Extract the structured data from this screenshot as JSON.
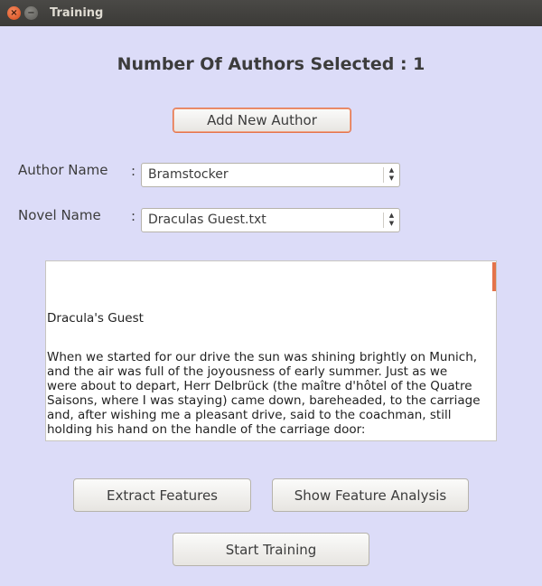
{
  "window": {
    "title": "Training",
    "close_glyph": "×",
    "minimize_glyph": "−"
  },
  "heading": "Number Of Authors Selected : 1",
  "buttons": {
    "add_author": "Add New Author",
    "extract": "Extract Features",
    "analysis": "Show Feature Analysis",
    "train": "Start Training"
  },
  "author": {
    "label": "Author Name",
    "colon": ":",
    "value": "Bramstocker"
  },
  "novel": {
    "label": "Novel Name",
    "colon": ":",
    "value": "Draculas Guest.txt"
  },
  "text_preview": {
    "title": "Dracula's Guest",
    "lines": [
      "When we started for our drive the sun was shining brightly on Munich,",
      "and the air was full of the joyousness of early summer. Just as we",
      "were about to depart, Herr Delbrück (the maître d'hôtel of the Quatre",
      "Saisons, where I was staying) came down, bareheaded, to the carriage",
      "and, after wishing me a pleasant drive, said to the coachman, still",
      "holding his hand on the handle of the carriage door:"
    ]
  },
  "colors": {
    "accent": "#e4734a",
    "background": "#dcdcf8"
  }
}
